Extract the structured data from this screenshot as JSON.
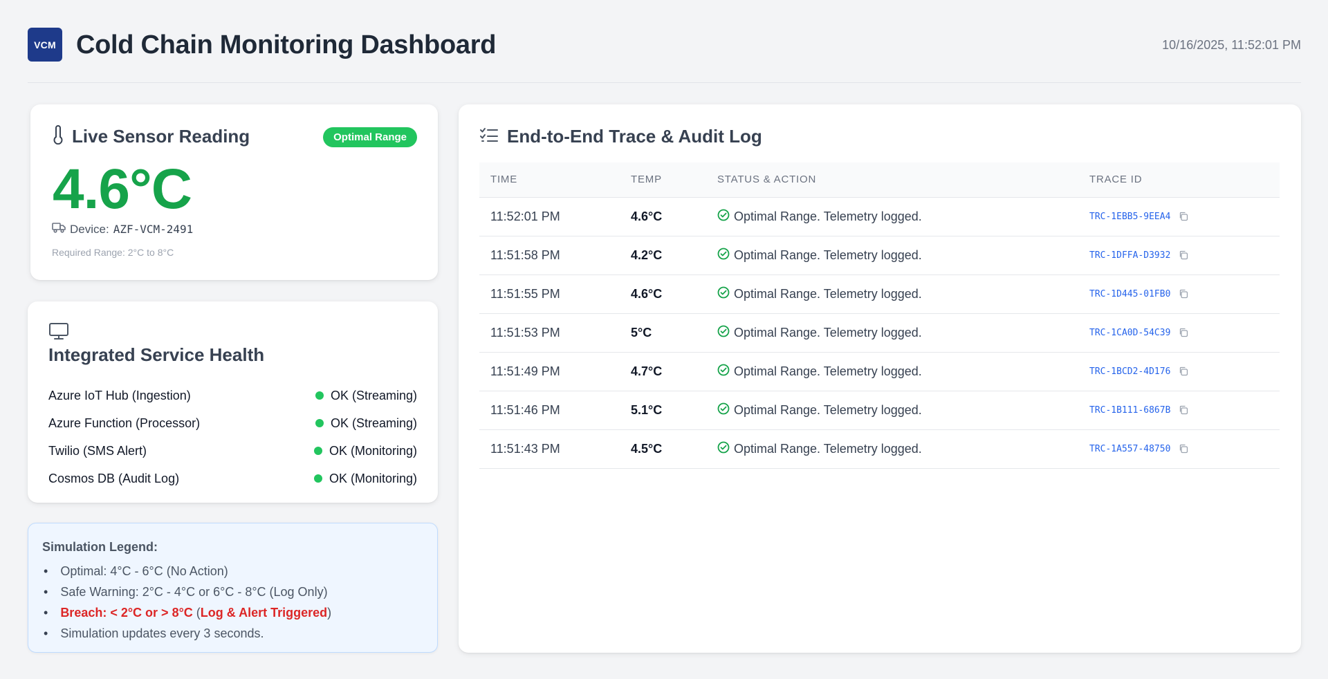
{
  "header": {
    "logo_text": "VCM",
    "title": "Cold Chain Monitoring Dashboard",
    "timestamp": "10/16/2025, 11:52:01 PM"
  },
  "sensor": {
    "title": "Live Sensor Reading",
    "badge": "Optimal Range",
    "temperature": "4.6°C",
    "device_label": "Device:",
    "device_id": "AZF-VCM-2491",
    "range_note": "Required Range: 2°C to 8°C",
    "icons": {
      "title": "thermometer-icon",
      "device": "truck-icon"
    },
    "colors": {
      "reading": "#16a34a",
      "badge": "#22c55e"
    }
  },
  "health": {
    "title": "Integrated Service Health",
    "icon": "monitor-icon",
    "services": [
      {
        "name": "Azure IoT Hub (Ingestion)",
        "status": "OK (Streaming)"
      },
      {
        "name": "Azure Function (Processor)",
        "status": "OK (Streaming)"
      },
      {
        "name": "Twilio (SMS Alert)",
        "status": "OK (Monitoring)"
      },
      {
        "name": "Cosmos DB (Audit Log)",
        "status": "OK (Monitoring)"
      }
    ],
    "status_color": "#22c55e"
  },
  "legend": {
    "title": "Simulation Legend:",
    "items": [
      "Optimal: 4°C - 6°C (No Action)",
      "Safe Warning: 2°C - 4°C or 6°C - 8°C (Log Only)",
      "Simulation updates every 3 seconds."
    ],
    "breach_prefix": "Breach: < 2°C or > 8°C",
    "breach_open": " (",
    "breach_action": "Log & Alert Triggered",
    "breach_close": ")",
    "breach_color": "#dc2626"
  },
  "log": {
    "title": "End-to-End Trace & Audit Log",
    "icon": "checklist-icon",
    "columns": [
      "TIME",
      "TEMP",
      "STATUS & ACTION",
      "TRACE ID"
    ],
    "rows": [
      {
        "time": "11:52:01 PM",
        "temp": "4.6°C",
        "status": "Optimal Range. Telemetry logged.",
        "trace_id": "TRC-1EBB5-9EEA4"
      },
      {
        "time": "11:51:58 PM",
        "temp": "4.2°C",
        "status": "Optimal Range. Telemetry logged.",
        "trace_id": "TRC-1DFFA-D3932"
      },
      {
        "time": "11:51:55 PM",
        "temp": "4.6°C",
        "status": "Optimal Range. Telemetry logged.",
        "trace_id": "TRC-1D445-01FB0"
      },
      {
        "time": "11:51:53 PM",
        "temp": "5°C",
        "status": "Optimal Range. Telemetry logged.",
        "trace_id": "TRC-1CA0D-54C39"
      },
      {
        "time": "11:51:49 PM",
        "temp": "4.7°C",
        "status": "Optimal Range. Telemetry logged.",
        "trace_id": "TRC-1BCD2-4D176"
      },
      {
        "time": "11:51:46 PM",
        "temp": "5.1°C",
        "status": "Optimal Range. Telemetry logged.",
        "trace_id": "TRC-1B111-6867B"
      },
      {
        "time": "11:51:43 PM",
        "temp": "4.5°C",
        "status": "Optimal Range. Telemetry logged.",
        "trace_id": "TRC-1A557-48750"
      }
    ],
    "status_icon": "check-circle-icon",
    "copy_icon": "copy-icon"
  }
}
